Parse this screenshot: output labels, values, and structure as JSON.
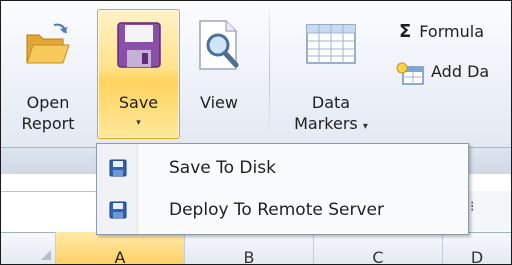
{
  "ribbon": {
    "open_report": {
      "line1": "Open",
      "line2": "Report",
      "icon": "folder-open-icon"
    },
    "save": {
      "label": "Save",
      "icon": "floppy-disk-icon",
      "arrow": "▾"
    },
    "view": {
      "label": "View",
      "icon": "magnify-icon"
    },
    "data_markers": {
      "line1": "Data",
      "line2": "Markers",
      "arrow": "▾",
      "icon": "grid-table-icon"
    },
    "formula": {
      "symbol": "Σ",
      "label": "Formula",
      "icon": "sigma-icon"
    },
    "add_data": {
      "label": "Add Da",
      "icon": "add-data-icon"
    }
  },
  "menu": {
    "items": [
      {
        "label": "Save To Disk",
        "icon": "floppy-disk-icon"
      },
      {
        "label": "Deploy To Remote Server",
        "icon": "floppy-disk-icon"
      }
    ]
  },
  "grid": {
    "columns": [
      "A",
      "B",
      "C",
      "D"
    ],
    "selected_column": "A"
  },
  "colors": {
    "save_highlight": "#ffd45e",
    "ribbon_bg": "#eef2f8",
    "menu_border": "#8e9aab",
    "selected_header": "#ffd167"
  }
}
